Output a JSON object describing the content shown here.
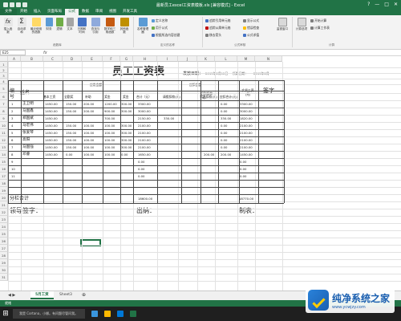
{
  "window": {
    "title": "最新员工excel工资表模板.xls [兼容模式] - Excel",
    "controls": [
      "?",
      "—",
      "□",
      "✕"
    ]
  },
  "ribbon_tabs": [
    "文件",
    "开始",
    "插入",
    "页面布局",
    "公式",
    "数据",
    "审阅",
    "视图",
    "开发工具"
  ],
  "ribbon": {
    "lib_buttons": [
      "插入函数",
      "自动求和",
      "最近使用的函数",
      "财务",
      "逻辑",
      "文本",
      "日期和时间",
      "查找与引用",
      "数学和三角函数",
      "其他函数"
    ],
    "name_manager": "名称管理器",
    "define_name": "定义名称",
    "use_in_formula": "用于公式",
    "create_from_sel": "根据所选内容创建",
    "trace_prec": "追踪引用单元格",
    "trace_dep": "追踪从属单元格",
    "remove_arrows": "移去箭头",
    "show_formulas": "显示公式",
    "error_check": "错误检查",
    "eval_formula": "公式求值",
    "watch": "监视窗口",
    "calc_options": "计算选项",
    "calc_now": "开始计算",
    "calc_sheet": "计算工作表",
    "groups": [
      "函数库",
      "定义的名称",
      "公式审核",
      "计算"
    ]
  },
  "formula_bar": {
    "name_box": "E25",
    "fx": "fx"
  },
  "columns": [
    "A",
    "B",
    "C",
    "D",
    "E",
    "F",
    "G",
    "H",
    "I",
    "J",
    "K",
    "L",
    "M",
    "N"
  ],
  "rows": [
    "1",
    "2",
    "3",
    "4",
    "5",
    "6",
    "7",
    "8",
    "9",
    "10",
    "11",
    "12",
    "13",
    "14",
    "15",
    "16",
    "17",
    "18",
    "19",
    "20",
    "21",
    "22",
    "23",
    "24",
    "25",
    "26",
    "27",
    "28",
    "29",
    "30",
    "31"
  ],
  "sheet": {
    "title": "员工工资表",
    "pay_date": "发放日期：",
    "pay_date_value": "2015年2月12日",
    "pay_month": "所属日期：",
    "pay_month_value": "2015年2月",
    "headers": {
      "no": "编号",
      "name": "姓名",
      "payable": "应发金额",
      "basic": "基本工资",
      "full": "全勤奖",
      "subsidy": "补助",
      "overtime": "奖金",
      "bonus": "奖金",
      "total": "合计（元）",
      "deduct": "应扣金额",
      "leave": "请假扣款(元)",
      "late": "迟到扣款(元)",
      "early": "早退扣款(元)",
      "deduct_total": "应扣合计(元)",
      "actual": "实发工资(元)",
      "sign": "签字"
    },
    "rows": [
      {
        "no": "1",
        "name": "王卫明",
        "basic": "1450.00",
        "full": "150.00",
        "subsidy": "200.00",
        "ot": "1200.00",
        "bonus": "300.00",
        "total": "3300.00",
        "leave": "",
        "late": "",
        "early": "",
        "dtotal": "0.00",
        "actual": "3300.00"
      },
      {
        "no": "2",
        "name": "马国鑫",
        "basic": "1450.00",
        "full": "150.00",
        "subsidy": "200.00",
        "ot": "900.00",
        "bonus": "300.00",
        "total": "3000.00",
        "leave": "",
        "late": "",
        "early": "",
        "dtotal": "0.00",
        "actual": "3000.00"
      },
      {
        "no": "3",
        "name": "郑国斌",
        "basic": "1450.00",
        "full": "",
        "subsidy": "",
        "ot": "700.00",
        "bonus": "",
        "total": "2150.00",
        "leave": "330.00",
        "late": "",
        "early": "",
        "dtotal": "330.00",
        "actual": "1820.00"
      },
      {
        "no": "4",
        "name": "马宏伟",
        "basic": "1450.00",
        "full": "150.00",
        "subsidy": "100.00",
        "ot": "100.00",
        "bonus": "300.00",
        "total": "2100.00",
        "leave": "",
        "late": "",
        "early": "",
        "dtotal": "0.00",
        "actual": "2100.00"
      },
      {
        "no": "5",
        "name": "张爱琴",
        "basic": "1450.00",
        "full": "150.00",
        "subsidy": "100.00",
        "ot": "100.00",
        "bonus": "300.00",
        "total": "2100.00",
        "leave": "",
        "late": "",
        "early": "",
        "dtotal": "0.00",
        "actual": "2100.00"
      },
      {
        "no": "6",
        "name": "高阳",
        "basic": "1450.00",
        "full": "150.00",
        "subsidy": "100.00",
        "ot": "100.00",
        "bonus": "300.00",
        "total": "2100.00",
        "leave": "",
        "late": "",
        "early": "",
        "dtotal": "0.00",
        "actual": "2100.00"
      },
      {
        "no": "7",
        "name": "马国强",
        "basic": "1450.00",
        "full": "150.00",
        "subsidy": "100.00",
        "ot": "100.00",
        "bonus": "300.00",
        "total": "2100.00",
        "leave": "",
        "late": "",
        "early": "",
        "dtotal": "0.00",
        "actual": "2100.00"
      },
      {
        "no": "8",
        "name": "邓睿",
        "basic": "1450.00",
        "full": "0.00",
        "subsidy": "100.00",
        "ot": "100.00",
        "bonus": "0.00",
        "total": "1650.00",
        "leave": "",
        "late": "",
        "early": "200.00",
        "dtotal": "200.00",
        "actual": "1450.00"
      },
      {
        "no": "9",
        "name": "",
        "basic": "",
        "full": "",
        "subsidy": "",
        "ot": "",
        "bonus": "",
        "total": "0.00",
        "leave": "",
        "late": "",
        "early": "",
        "dtotal": "",
        "actual": "0.00"
      },
      {
        "no": "10",
        "name": "",
        "basic": "",
        "full": "",
        "subsidy": "",
        "ot": "",
        "bonus": "",
        "total": "0.00",
        "leave": "",
        "late": "",
        "early": "",
        "dtotal": "",
        "actual": "0.00"
      },
      {
        "no": "11",
        "name": "",
        "basic": "",
        "full": "",
        "subsidy": "",
        "ot": "",
        "bonus": "",
        "total": "0.00",
        "leave": "",
        "late": "",
        "early": "",
        "dtotal": "",
        "actual": "0.00"
      }
    ],
    "subtotal_label": "分栏合计",
    "subtotal_total": "18600.00",
    "subtotal_actual": "18770.00",
    "leader_sign": "领导签字：",
    "cashier": "出纳：",
    "preparer": "制表："
  },
  "sheet_tabs": [
    "5月工资",
    "Sheet3"
  ],
  "status": "就绪",
  "taskbar": {
    "search": "我是 Cortana，小娜。有问题尽管问我。"
  },
  "watermark": {
    "line1": "纯净系统之家",
    "line2": "www.ycwjzy.com"
  }
}
